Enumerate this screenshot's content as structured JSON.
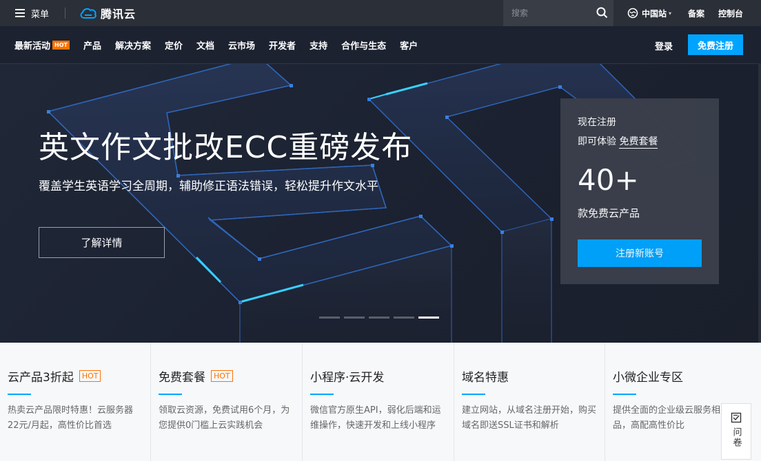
{
  "topbar": {
    "menu_label": "菜单",
    "logo_text": "腾讯云",
    "search_placeholder": "搜索",
    "region_label": "中国站",
    "links": [
      "备案",
      "控制台"
    ]
  },
  "nav": {
    "items": [
      {
        "label": "最新活动",
        "badge": "HOT"
      },
      {
        "label": "产品"
      },
      {
        "label": "解决方案"
      },
      {
        "label": "定价"
      },
      {
        "label": "文档"
      },
      {
        "label": "云市场"
      },
      {
        "label": "开发者"
      },
      {
        "label": "支持"
      },
      {
        "label": "合作与生态"
      },
      {
        "label": "客户"
      }
    ],
    "login_label": "登录",
    "signup_label": "免费注册"
  },
  "hero": {
    "title": "英文作文批改ECC重磅发布",
    "subtitle": "覆盖学生英语学习全周期，辅助修正语法错误，轻松提升作文水平",
    "cta_label": "了解详情",
    "carousel_count": 5,
    "carousel_active": 5
  },
  "promo": {
    "line1": "现在注册",
    "line2_prefix": "即可体验 ",
    "line2_link": "免费套餐",
    "number": "40+",
    "line3": "款免费云产品",
    "button_label": "注册新账号"
  },
  "cards": [
    {
      "title": "云产品3折起",
      "badge": "HOT",
      "desc": "热卖云产品限时特惠！云服务器22元/月起，高性价比首选"
    },
    {
      "title": "免费套餐",
      "badge": "HOT",
      "desc": "领取云资源，免费试用6个月，为您提供0门槛上云实践机会"
    },
    {
      "title": "小程序·云开发",
      "badge": "",
      "desc": "微信官方原生API，弱化后端和运维操作，快速开发和上线小程序"
    },
    {
      "title": "域名特惠",
      "badge": "",
      "desc": "建立网站，从域名注册开始，购买域名即送SSL证书和解析"
    },
    {
      "title": "小微企业专区",
      "badge": "",
      "desc": "提供全面的企业级云服务相关产品，高配高性价比"
    }
  ],
  "survey": {
    "label": "问卷",
    "icon": "survey-icon"
  },
  "colors": {
    "accent": "#00a4ff",
    "hot": "#ff7200",
    "topbar": "#2b2f37",
    "hero_bg": "#1c2230"
  }
}
